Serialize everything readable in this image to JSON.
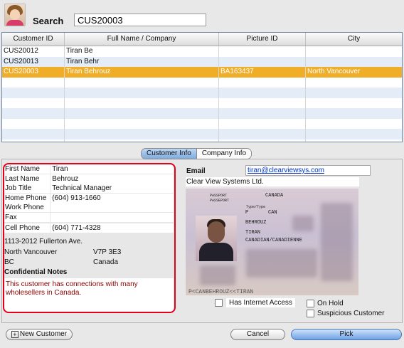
{
  "search": {
    "label": "Search",
    "value": "CUS20003"
  },
  "table": {
    "columns": [
      "Customer ID",
      "Full Name / Company",
      "Picture ID",
      "City"
    ],
    "rows": [
      [
        "CUS20012",
        "Tiran Be",
        "",
        ""
      ],
      [
        "CUS20013",
        "Tiran Behr",
        "",
        ""
      ],
      [
        "CUS20003",
        "Tiran Behrouz",
        "BA163437",
        "North Vancouver"
      ]
    ],
    "selected_row": 3
  },
  "tabs": {
    "customer_info": "Customer Info",
    "company_info": "Company Info"
  },
  "fields": [
    {
      "label": "First Name",
      "value": "Tiran"
    },
    {
      "label": "Last Name",
      "value": "Behrouz"
    },
    {
      "label": "Job Title",
      "value": "Technical Manager"
    },
    {
      "label": "Home Phone",
      "value": "(604) 913-1660"
    },
    {
      "label": "Work Phone",
      "value": ""
    },
    {
      "label": "Fax",
      "value": ""
    },
    {
      "label": "Cell Phone",
      "value": "(604) 771-4328"
    }
  ],
  "address": {
    "street": "1113-2012 Fullerton Ave.",
    "city": "North Vancouver",
    "postal": "V7P 3E3",
    "province": "BC",
    "country": "Canada"
  },
  "notes": {
    "label": "Confidential Notes",
    "text": "This customer has connections with many wholesellers in Canada."
  },
  "email": {
    "label": "Email",
    "value": "tiran@clearviewsys.com"
  },
  "company": "Clear View Systems Ltd.",
  "passport": {
    "header_left": "PASSPORT",
    "header_left_fr": "PASSEPORT",
    "country": "CANADA",
    "type_label": "Type/Type",
    "type": "P",
    "code": "CAN",
    "surname": "BEHROUZ",
    "given": "TIRAN",
    "nationality": "CANADIAN/CANADIENNE",
    "mrz": "P<CANBEHROUZ<<TIRAN"
  },
  "checks": {
    "internet": "Has Internet Access",
    "on_hold": "On Hold",
    "suspicious": "Suspicious Customer"
  },
  "buttons": {
    "new_customer": "New Customer",
    "cancel": "Cancel",
    "pick": "Pick"
  },
  "colors": {
    "selection": "#f0ad28",
    "notes_text": "#8b0000",
    "highlight_box": "#e2001a",
    "pick_button": "#6da2e4"
  }
}
